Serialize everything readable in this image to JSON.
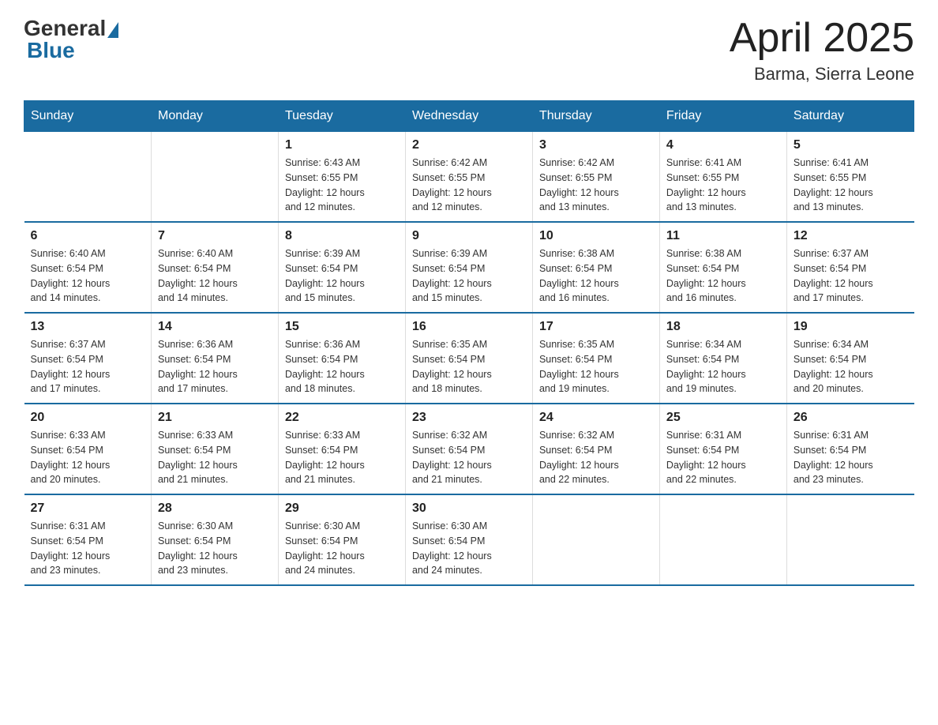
{
  "header": {
    "logo_general": "General",
    "logo_blue": "Blue",
    "month_title": "April 2025",
    "location": "Barma, Sierra Leone"
  },
  "weekdays": [
    "Sunday",
    "Monday",
    "Tuesday",
    "Wednesday",
    "Thursday",
    "Friday",
    "Saturday"
  ],
  "weeks": [
    [
      {
        "day": "",
        "info": ""
      },
      {
        "day": "",
        "info": ""
      },
      {
        "day": "1",
        "info": "Sunrise: 6:43 AM\nSunset: 6:55 PM\nDaylight: 12 hours\nand 12 minutes."
      },
      {
        "day": "2",
        "info": "Sunrise: 6:42 AM\nSunset: 6:55 PM\nDaylight: 12 hours\nand 12 minutes."
      },
      {
        "day": "3",
        "info": "Sunrise: 6:42 AM\nSunset: 6:55 PM\nDaylight: 12 hours\nand 13 minutes."
      },
      {
        "day": "4",
        "info": "Sunrise: 6:41 AM\nSunset: 6:55 PM\nDaylight: 12 hours\nand 13 minutes."
      },
      {
        "day": "5",
        "info": "Sunrise: 6:41 AM\nSunset: 6:55 PM\nDaylight: 12 hours\nand 13 minutes."
      }
    ],
    [
      {
        "day": "6",
        "info": "Sunrise: 6:40 AM\nSunset: 6:54 PM\nDaylight: 12 hours\nand 14 minutes."
      },
      {
        "day": "7",
        "info": "Sunrise: 6:40 AM\nSunset: 6:54 PM\nDaylight: 12 hours\nand 14 minutes."
      },
      {
        "day": "8",
        "info": "Sunrise: 6:39 AM\nSunset: 6:54 PM\nDaylight: 12 hours\nand 15 minutes."
      },
      {
        "day": "9",
        "info": "Sunrise: 6:39 AM\nSunset: 6:54 PM\nDaylight: 12 hours\nand 15 minutes."
      },
      {
        "day": "10",
        "info": "Sunrise: 6:38 AM\nSunset: 6:54 PM\nDaylight: 12 hours\nand 16 minutes."
      },
      {
        "day": "11",
        "info": "Sunrise: 6:38 AM\nSunset: 6:54 PM\nDaylight: 12 hours\nand 16 minutes."
      },
      {
        "day": "12",
        "info": "Sunrise: 6:37 AM\nSunset: 6:54 PM\nDaylight: 12 hours\nand 17 minutes."
      }
    ],
    [
      {
        "day": "13",
        "info": "Sunrise: 6:37 AM\nSunset: 6:54 PM\nDaylight: 12 hours\nand 17 minutes."
      },
      {
        "day": "14",
        "info": "Sunrise: 6:36 AM\nSunset: 6:54 PM\nDaylight: 12 hours\nand 17 minutes."
      },
      {
        "day": "15",
        "info": "Sunrise: 6:36 AM\nSunset: 6:54 PM\nDaylight: 12 hours\nand 18 minutes."
      },
      {
        "day": "16",
        "info": "Sunrise: 6:35 AM\nSunset: 6:54 PM\nDaylight: 12 hours\nand 18 minutes."
      },
      {
        "day": "17",
        "info": "Sunrise: 6:35 AM\nSunset: 6:54 PM\nDaylight: 12 hours\nand 19 minutes."
      },
      {
        "day": "18",
        "info": "Sunrise: 6:34 AM\nSunset: 6:54 PM\nDaylight: 12 hours\nand 19 minutes."
      },
      {
        "day": "19",
        "info": "Sunrise: 6:34 AM\nSunset: 6:54 PM\nDaylight: 12 hours\nand 20 minutes."
      }
    ],
    [
      {
        "day": "20",
        "info": "Sunrise: 6:33 AM\nSunset: 6:54 PM\nDaylight: 12 hours\nand 20 minutes."
      },
      {
        "day": "21",
        "info": "Sunrise: 6:33 AM\nSunset: 6:54 PM\nDaylight: 12 hours\nand 21 minutes."
      },
      {
        "day": "22",
        "info": "Sunrise: 6:33 AM\nSunset: 6:54 PM\nDaylight: 12 hours\nand 21 minutes."
      },
      {
        "day": "23",
        "info": "Sunrise: 6:32 AM\nSunset: 6:54 PM\nDaylight: 12 hours\nand 21 minutes."
      },
      {
        "day": "24",
        "info": "Sunrise: 6:32 AM\nSunset: 6:54 PM\nDaylight: 12 hours\nand 22 minutes."
      },
      {
        "day": "25",
        "info": "Sunrise: 6:31 AM\nSunset: 6:54 PM\nDaylight: 12 hours\nand 22 minutes."
      },
      {
        "day": "26",
        "info": "Sunrise: 6:31 AM\nSunset: 6:54 PM\nDaylight: 12 hours\nand 23 minutes."
      }
    ],
    [
      {
        "day": "27",
        "info": "Sunrise: 6:31 AM\nSunset: 6:54 PM\nDaylight: 12 hours\nand 23 minutes."
      },
      {
        "day": "28",
        "info": "Sunrise: 6:30 AM\nSunset: 6:54 PM\nDaylight: 12 hours\nand 23 minutes."
      },
      {
        "day": "29",
        "info": "Sunrise: 6:30 AM\nSunset: 6:54 PM\nDaylight: 12 hours\nand 24 minutes."
      },
      {
        "day": "30",
        "info": "Sunrise: 6:30 AM\nSunset: 6:54 PM\nDaylight: 12 hours\nand 24 minutes."
      },
      {
        "day": "",
        "info": ""
      },
      {
        "day": "",
        "info": ""
      },
      {
        "day": "",
        "info": ""
      }
    ]
  ]
}
